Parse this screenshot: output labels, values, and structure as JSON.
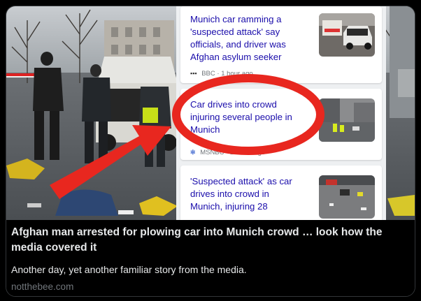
{
  "card": {
    "headline": "Afghan man arrested for plowing car into Munich crowd … look how the media covered it",
    "description": "Another day, yet another familiar story from the media.",
    "domain": "notthebee.com"
  },
  "news_panel": {
    "items": [
      {
        "title": "Munich car ramming a 'suspected attack' say officials, and driver was Afghan asylum seeker",
        "source": "BBC",
        "time": "1 hour ago",
        "source_icon": "bbc-icon"
      },
      {
        "title": "Car drives into crowd injuring several people in Munich",
        "source": "MSNBC",
        "time": "2 hours ago",
        "source_icon": "msnbc-peacock-icon"
      },
      {
        "title": "'Suspected attack' as car drives into crowd in Munich, injuring 28",
        "source": "",
        "time": "",
        "source_icon": "source-icon"
      }
    ]
  },
  "colors": {
    "link_blue": "#1a0dab",
    "annotation_red": "#e8271f",
    "card_border": "#333639",
    "text_primary": "#e7e9ea",
    "text_secondary": "#71767b"
  }
}
